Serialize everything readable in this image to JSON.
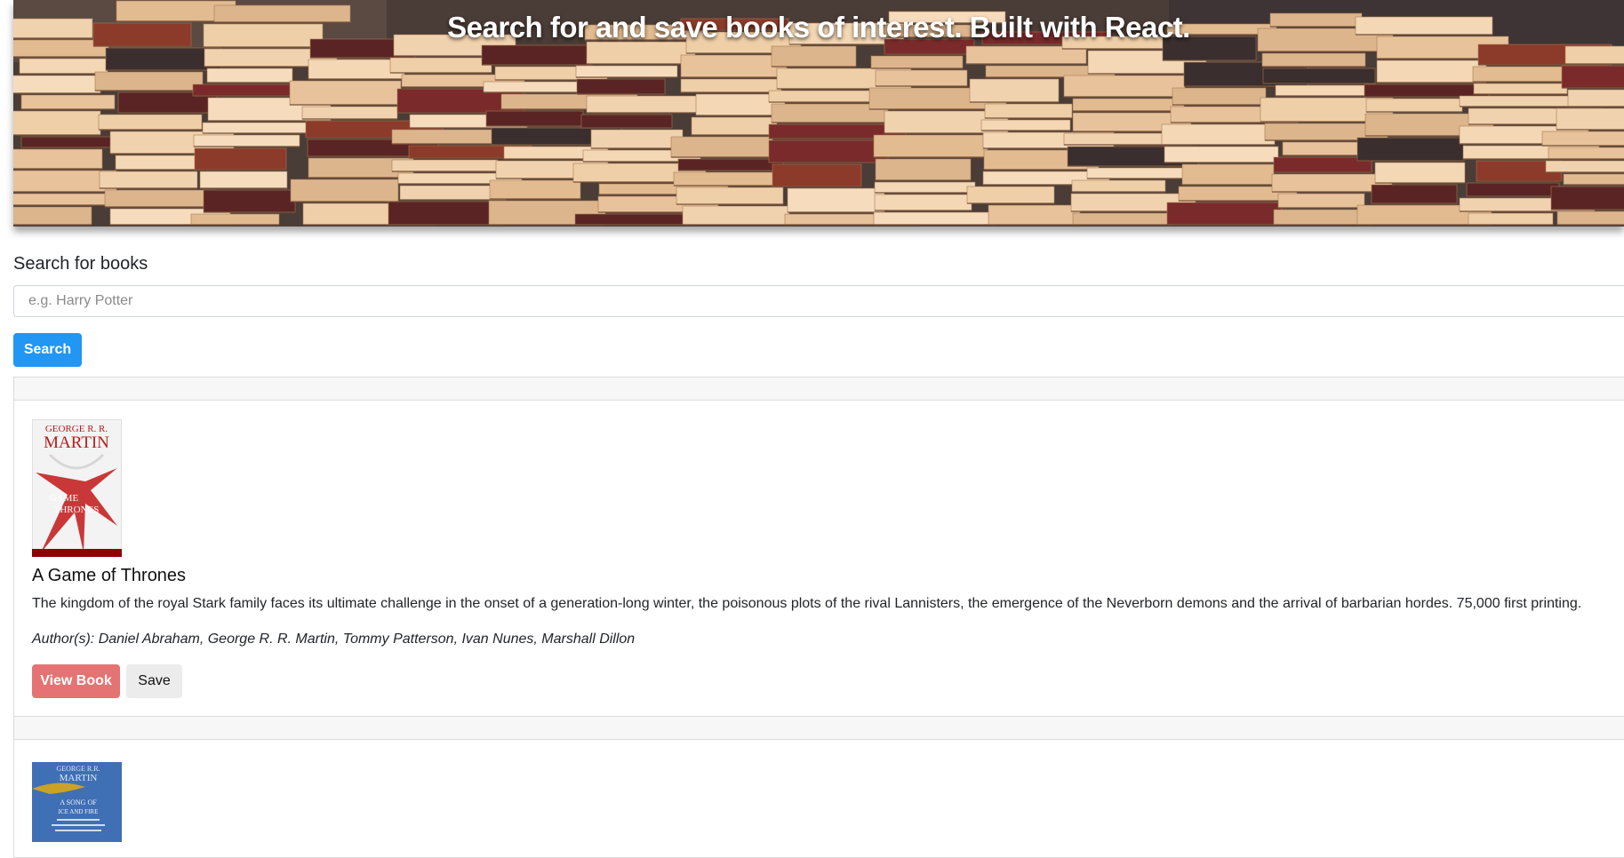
{
  "hero": {
    "title": "Search for and save books of interest. Built with React."
  },
  "search": {
    "label": "Search for books",
    "placeholder": "e.g. Harry Potter",
    "value": "",
    "button_label": "Search"
  },
  "results": [
    {
      "title": "A Game of Thrones",
      "description": "The kingdom of the royal Stark family faces its ultimate challenge in the onset of a generation-long winter, the poisonous plots of the rival Lannisters, the emergence of the Neverborn demons and the arrival of barbarian hordes. 75,000 first printing.",
      "authors_prefix": "Author(s):",
      "authors": "Daniel Abraham, George R. R. Martin, Tommy Patterson, Ivan Nunes, Marshall Dillon",
      "cover": {
        "author_line1": "GEORGE R. R.",
        "author_line2": "MARTIN",
        "title_line1": "GAME",
        "title_line2": "THRONES",
        "color": "#c62828"
      },
      "view_label": "View Book",
      "save_label": "Save"
    },
    {
      "cover": {
        "author_line1": "GEORGE R.R.",
        "author_line2": "MARTIN",
        "title_line1": "A SONG OF",
        "title_line2": "ICE AND FIRE",
        "color": "#3f6fb5"
      }
    }
  ],
  "colors": {
    "primary": "#2196f3",
    "view_button": "#e57373",
    "save_button": "#ececec"
  }
}
